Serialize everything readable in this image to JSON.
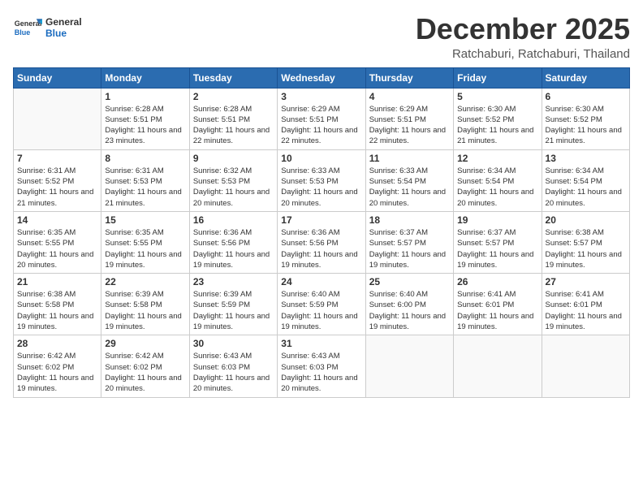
{
  "header": {
    "logo_general": "General",
    "logo_blue": "Blue",
    "month_title": "December 2025",
    "location": "Ratchaburi, Ratchaburi, Thailand"
  },
  "weekdays": [
    "Sunday",
    "Monday",
    "Tuesday",
    "Wednesday",
    "Thursday",
    "Friday",
    "Saturday"
  ],
  "weeks": [
    [
      {
        "day": "",
        "sunrise": "",
        "sunset": "",
        "daylight": ""
      },
      {
        "day": "1",
        "sunrise": "6:28 AM",
        "sunset": "5:51 PM",
        "daylight": "11 hours and 23 minutes."
      },
      {
        "day": "2",
        "sunrise": "6:28 AM",
        "sunset": "5:51 PM",
        "daylight": "11 hours and 22 minutes."
      },
      {
        "day": "3",
        "sunrise": "6:29 AM",
        "sunset": "5:51 PM",
        "daylight": "11 hours and 22 minutes."
      },
      {
        "day": "4",
        "sunrise": "6:29 AM",
        "sunset": "5:51 PM",
        "daylight": "11 hours and 22 minutes."
      },
      {
        "day": "5",
        "sunrise": "6:30 AM",
        "sunset": "5:52 PM",
        "daylight": "11 hours and 21 minutes."
      },
      {
        "day": "6",
        "sunrise": "6:30 AM",
        "sunset": "5:52 PM",
        "daylight": "11 hours and 21 minutes."
      }
    ],
    [
      {
        "day": "7",
        "sunrise": "6:31 AM",
        "sunset": "5:52 PM",
        "daylight": "11 hours and 21 minutes."
      },
      {
        "day": "8",
        "sunrise": "6:31 AM",
        "sunset": "5:53 PM",
        "daylight": "11 hours and 21 minutes."
      },
      {
        "day": "9",
        "sunrise": "6:32 AM",
        "sunset": "5:53 PM",
        "daylight": "11 hours and 20 minutes."
      },
      {
        "day": "10",
        "sunrise": "6:33 AM",
        "sunset": "5:53 PM",
        "daylight": "11 hours and 20 minutes."
      },
      {
        "day": "11",
        "sunrise": "6:33 AM",
        "sunset": "5:54 PM",
        "daylight": "11 hours and 20 minutes."
      },
      {
        "day": "12",
        "sunrise": "6:34 AM",
        "sunset": "5:54 PM",
        "daylight": "11 hours and 20 minutes."
      },
      {
        "day": "13",
        "sunrise": "6:34 AM",
        "sunset": "5:54 PM",
        "daylight": "11 hours and 20 minutes."
      }
    ],
    [
      {
        "day": "14",
        "sunrise": "6:35 AM",
        "sunset": "5:55 PM",
        "daylight": "11 hours and 20 minutes."
      },
      {
        "day": "15",
        "sunrise": "6:35 AM",
        "sunset": "5:55 PM",
        "daylight": "11 hours and 19 minutes."
      },
      {
        "day": "16",
        "sunrise": "6:36 AM",
        "sunset": "5:56 PM",
        "daylight": "11 hours and 19 minutes."
      },
      {
        "day": "17",
        "sunrise": "6:36 AM",
        "sunset": "5:56 PM",
        "daylight": "11 hours and 19 minutes."
      },
      {
        "day": "18",
        "sunrise": "6:37 AM",
        "sunset": "5:57 PM",
        "daylight": "11 hours and 19 minutes."
      },
      {
        "day": "19",
        "sunrise": "6:37 AM",
        "sunset": "5:57 PM",
        "daylight": "11 hours and 19 minutes."
      },
      {
        "day": "20",
        "sunrise": "6:38 AM",
        "sunset": "5:57 PM",
        "daylight": "11 hours and 19 minutes."
      }
    ],
    [
      {
        "day": "21",
        "sunrise": "6:38 AM",
        "sunset": "5:58 PM",
        "daylight": "11 hours and 19 minutes."
      },
      {
        "day": "22",
        "sunrise": "6:39 AM",
        "sunset": "5:58 PM",
        "daylight": "11 hours and 19 minutes."
      },
      {
        "day": "23",
        "sunrise": "6:39 AM",
        "sunset": "5:59 PM",
        "daylight": "11 hours and 19 minutes."
      },
      {
        "day": "24",
        "sunrise": "6:40 AM",
        "sunset": "5:59 PM",
        "daylight": "11 hours and 19 minutes."
      },
      {
        "day": "25",
        "sunrise": "6:40 AM",
        "sunset": "6:00 PM",
        "daylight": "11 hours and 19 minutes."
      },
      {
        "day": "26",
        "sunrise": "6:41 AM",
        "sunset": "6:01 PM",
        "daylight": "11 hours and 19 minutes."
      },
      {
        "day": "27",
        "sunrise": "6:41 AM",
        "sunset": "6:01 PM",
        "daylight": "11 hours and 19 minutes."
      }
    ],
    [
      {
        "day": "28",
        "sunrise": "6:42 AM",
        "sunset": "6:02 PM",
        "daylight": "11 hours and 19 minutes."
      },
      {
        "day": "29",
        "sunrise": "6:42 AM",
        "sunset": "6:02 PM",
        "daylight": "11 hours and 20 minutes."
      },
      {
        "day": "30",
        "sunrise": "6:43 AM",
        "sunset": "6:03 PM",
        "daylight": "11 hours and 20 minutes."
      },
      {
        "day": "31",
        "sunrise": "6:43 AM",
        "sunset": "6:03 PM",
        "daylight": "11 hours and 20 minutes."
      },
      {
        "day": "",
        "sunrise": "",
        "sunset": "",
        "daylight": ""
      },
      {
        "day": "",
        "sunrise": "",
        "sunset": "",
        "daylight": ""
      },
      {
        "day": "",
        "sunrise": "",
        "sunset": "",
        "daylight": ""
      }
    ]
  ]
}
